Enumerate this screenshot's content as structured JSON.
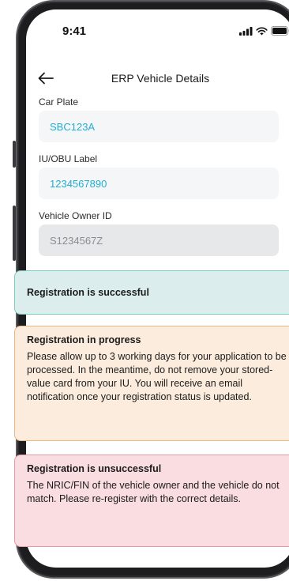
{
  "status_bar": {
    "time": "9:41",
    "signal_icon": "cellular-signal-icon",
    "wifi_icon": "wifi-icon",
    "battery_icon": "battery-icon"
  },
  "header": {
    "back_icon": "back-arrow-icon",
    "title": "ERP Vehicle Details"
  },
  "form": {
    "car_plate": {
      "label": "Car Plate",
      "value": "SBC123A"
    },
    "iu_obu": {
      "label": "IU/OBU Label",
      "value": "1234567890"
    },
    "owner_id": {
      "label": "Vehicle Owner ID",
      "value": "S1234567Z"
    }
  },
  "alerts": {
    "success": {
      "title": "Registration is successful"
    },
    "progress": {
      "title": "Registration in progress",
      "body": "Please allow up to 3 working days for your application to be processed. In the meantime, do not remove your stored-value card from your IU. You will receive an email notification once your registration status is updated."
    },
    "fail": {
      "title": "Registration is unsuccessful",
      "body": "The NRIC/FIN of the vehicle owner and the vehicle do not match. Please re-register with the correct details."
    }
  },
  "colors": {
    "value_text": "#22aed1",
    "success_bg": "#dbeeed",
    "progress_bg": "#fcecdd",
    "fail_bg": "#f9dde0"
  }
}
